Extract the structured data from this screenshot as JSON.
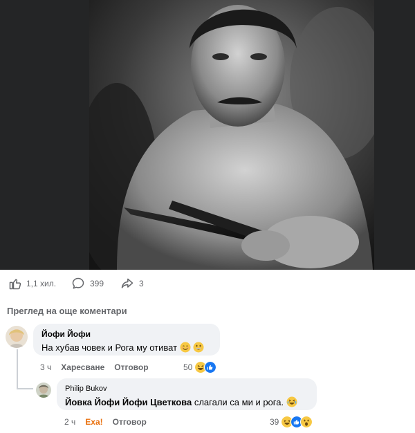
{
  "post": {
    "likes": "1,1 хил.",
    "comments": "399",
    "shares": "3"
  },
  "more_comments_label": "Преглед на още коментари",
  "comments": [
    {
      "author": "Йофи Йофи",
      "text": "На хубав човек и Рога му отиват",
      "emoji": [
        "smiling-face",
        "grinning-face"
      ],
      "time": "3 ч",
      "like_label": "Харесване",
      "reply_label": "Отговор",
      "reaction_count": "50",
      "reactions": [
        "laughing",
        "like"
      ]
    },
    {
      "author": "Philip Bukov",
      "mention": "Йовка Йофи Йофи Цветкова",
      "text": "слагали са ми и рога.",
      "emoji": [
        "laughing-crying-face"
      ],
      "time": "2 ч",
      "like_label": "Еха!",
      "reply_label": "Отговор",
      "reaction_count": "39",
      "reactions": [
        "laughing",
        "like",
        "wow"
      ]
    }
  ],
  "colors": {
    "bubble": "#f0f2f5",
    "muted": "#65676b",
    "like_blue": "#1877f2",
    "wow_orange": "#e9710f"
  }
}
